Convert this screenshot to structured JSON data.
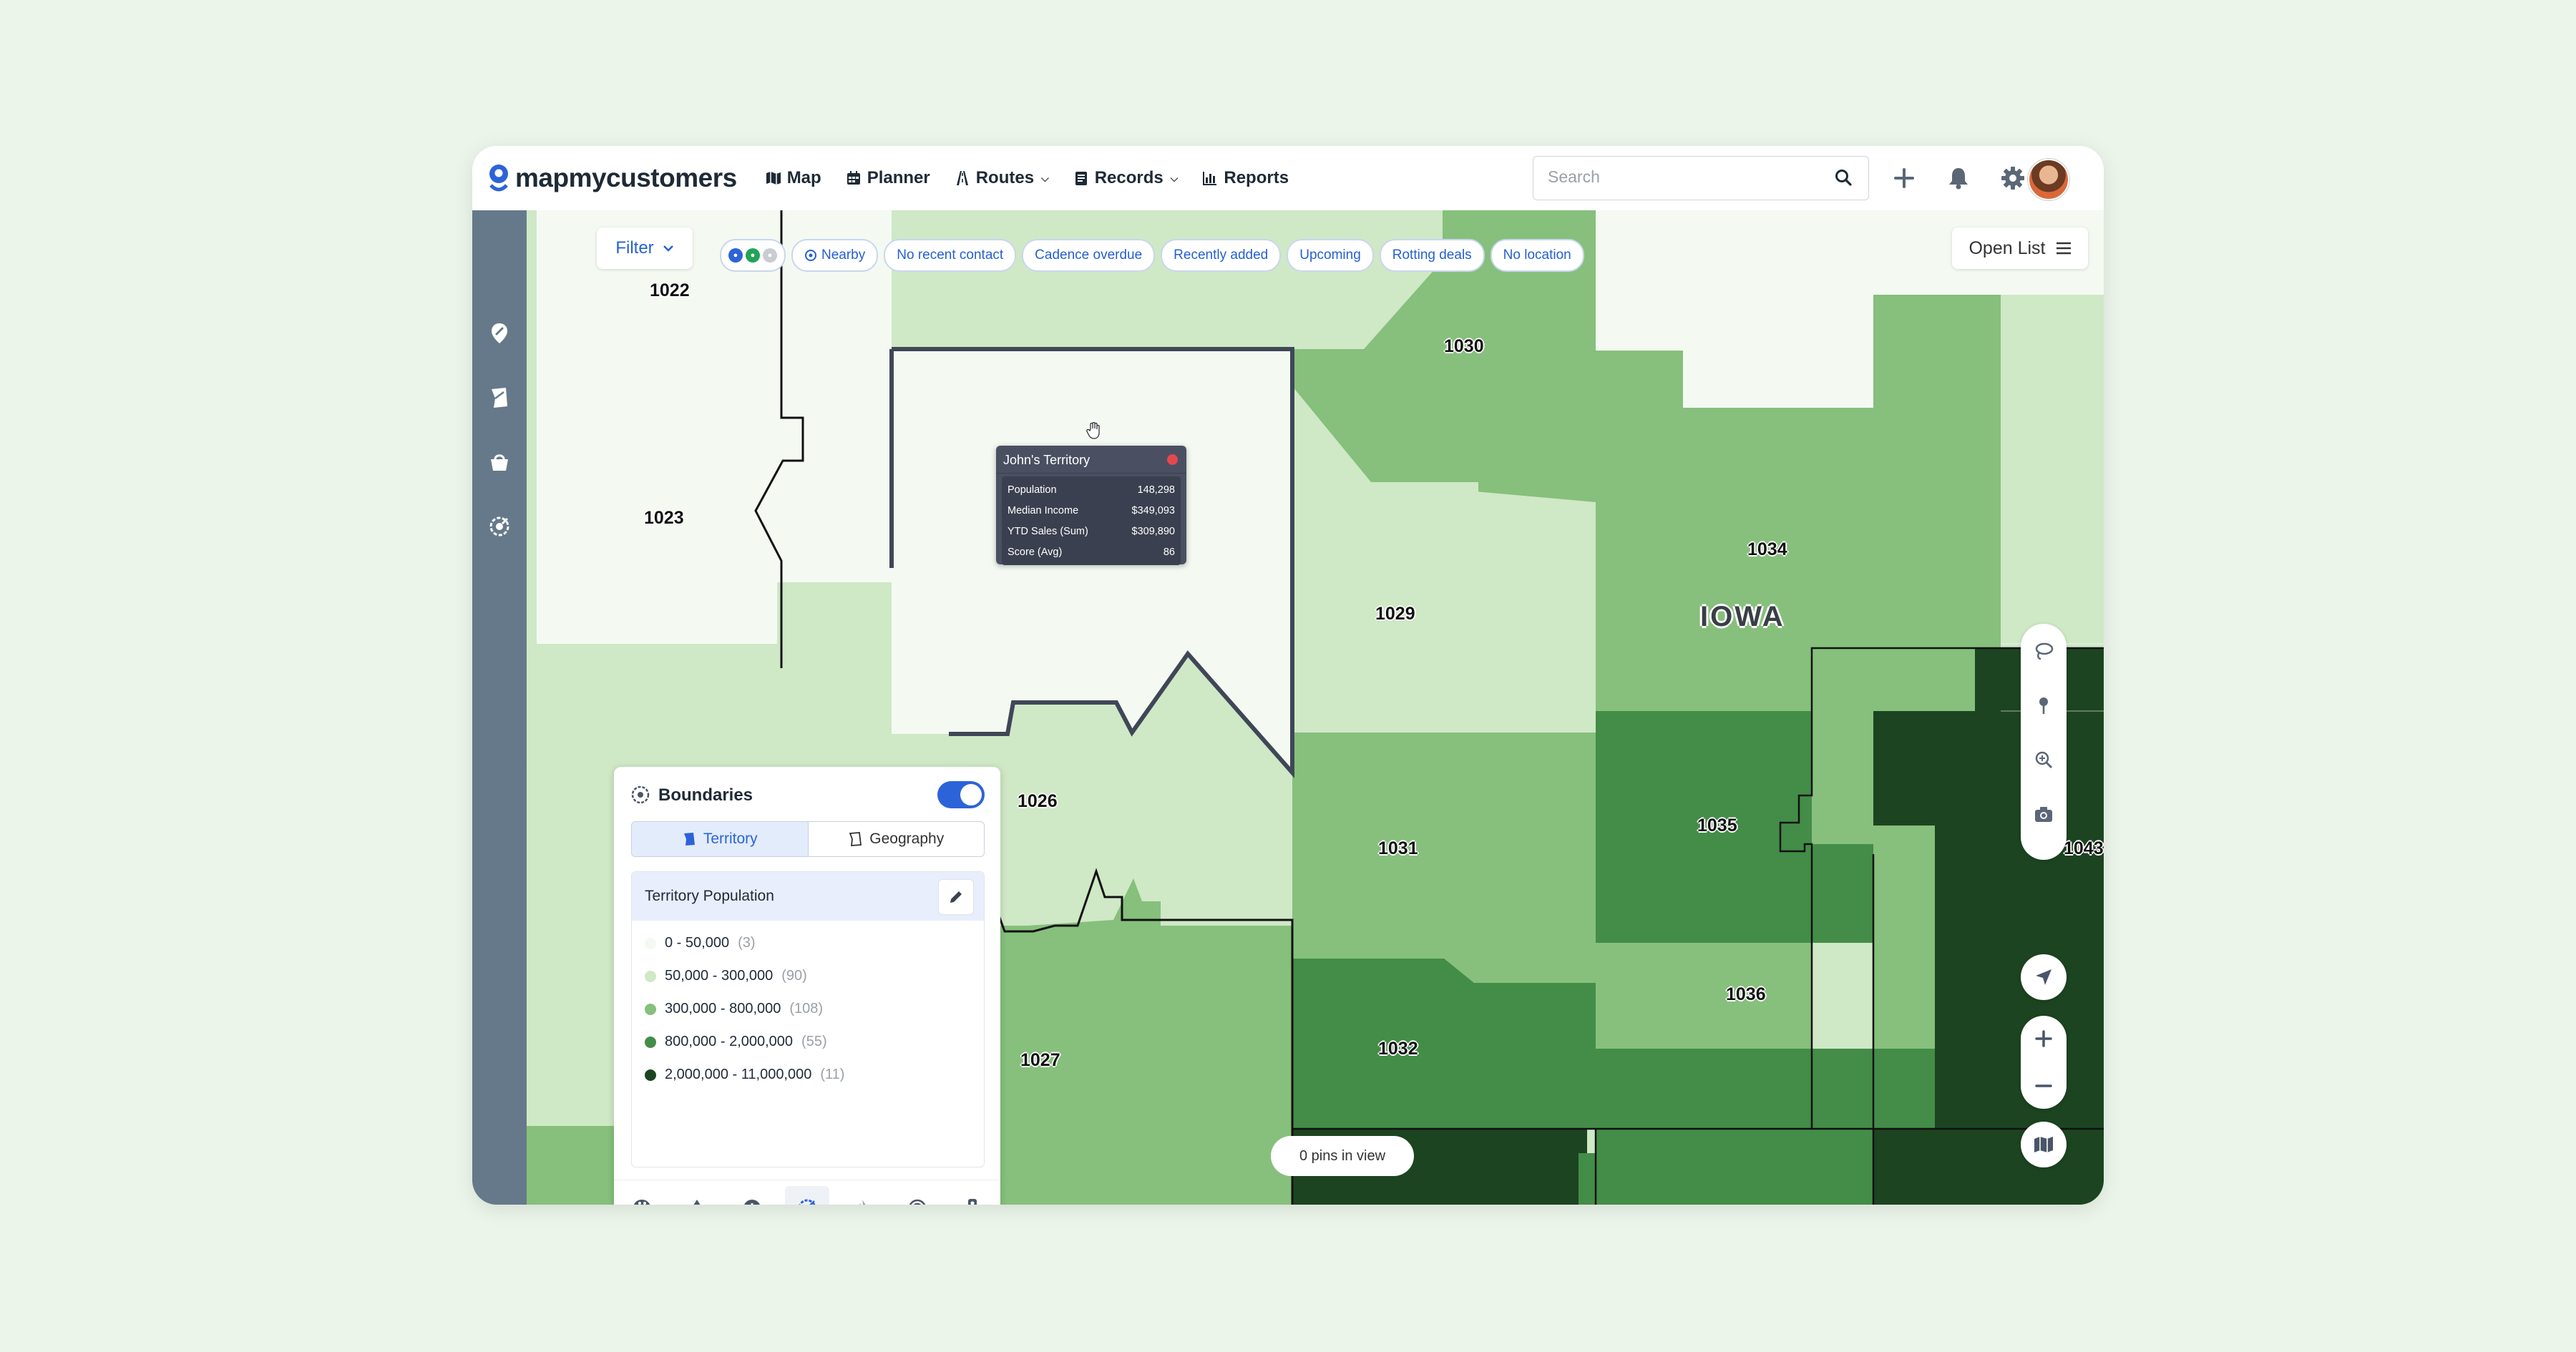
{
  "app": {
    "brand": "mapmycustomers",
    "nav": [
      {
        "label": "Map"
      },
      {
        "label": "Planner"
      },
      {
        "label": "Routes"
      },
      {
        "label": "Records"
      },
      {
        "label": "Reports"
      }
    ],
    "search_placeholder": "Search"
  },
  "toolbar": {
    "filter_label": "Filter",
    "chips": [
      "Nearby",
      "No recent contact",
      "Cadence overdue",
      "Recently added",
      "Upcoming",
      "Rotting deals",
      "No location"
    ],
    "open_list_label": "Open List"
  },
  "map": {
    "state_label": "IOWA",
    "zip_labels": [
      "1022",
      "1023",
      "1026",
      "1027",
      "1029",
      "1030",
      "1031",
      "1032",
      "1034",
      "1035",
      "1036",
      "1043"
    ],
    "pins_in_view": "0 pins in view",
    "colors": {
      "tier1": "#f4faf2",
      "tier2": "#cfe8c6",
      "tier3": "#86c07c",
      "tier4": "#438d48",
      "tier5": "#1c4420"
    }
  },
  "tooltip": {
    "title": "John's Territory",
    "rows": [
      {
        "label": "Population",
        "value": "148,298"
      },
      {
        "label": "Median Income",
        "value": "$349,093"
      },
      {
        "label": "YTD Sales (Sum)",
        "value": "$309,890"
      },
      {
        "label": "Score (Avg)",
        "value": "86"
      }
    ]
  },
  "boundaries": {
    "title": "Boundaries",
    "tab_territory": "Territory",
    "tab_geography": "Geography",
    "legend_title": "Territory Population",
    "legend": [
      {
        "range": "0 - 50,000",
        "count": "(3)"
      },
      {
        "range": "50,000 - 300,000",
        "count": "(90)"
      },
      {
        "range": "300,000 - 800,000",
        "count": "(108)"
      },
      {
        "range": "800,000 - 2,000,000",
        "count": "(55)"
      },
      {
        "range": "2,000,000 - 11,000,000",
        "count": "(11)"
      }
    ]
  }
}
